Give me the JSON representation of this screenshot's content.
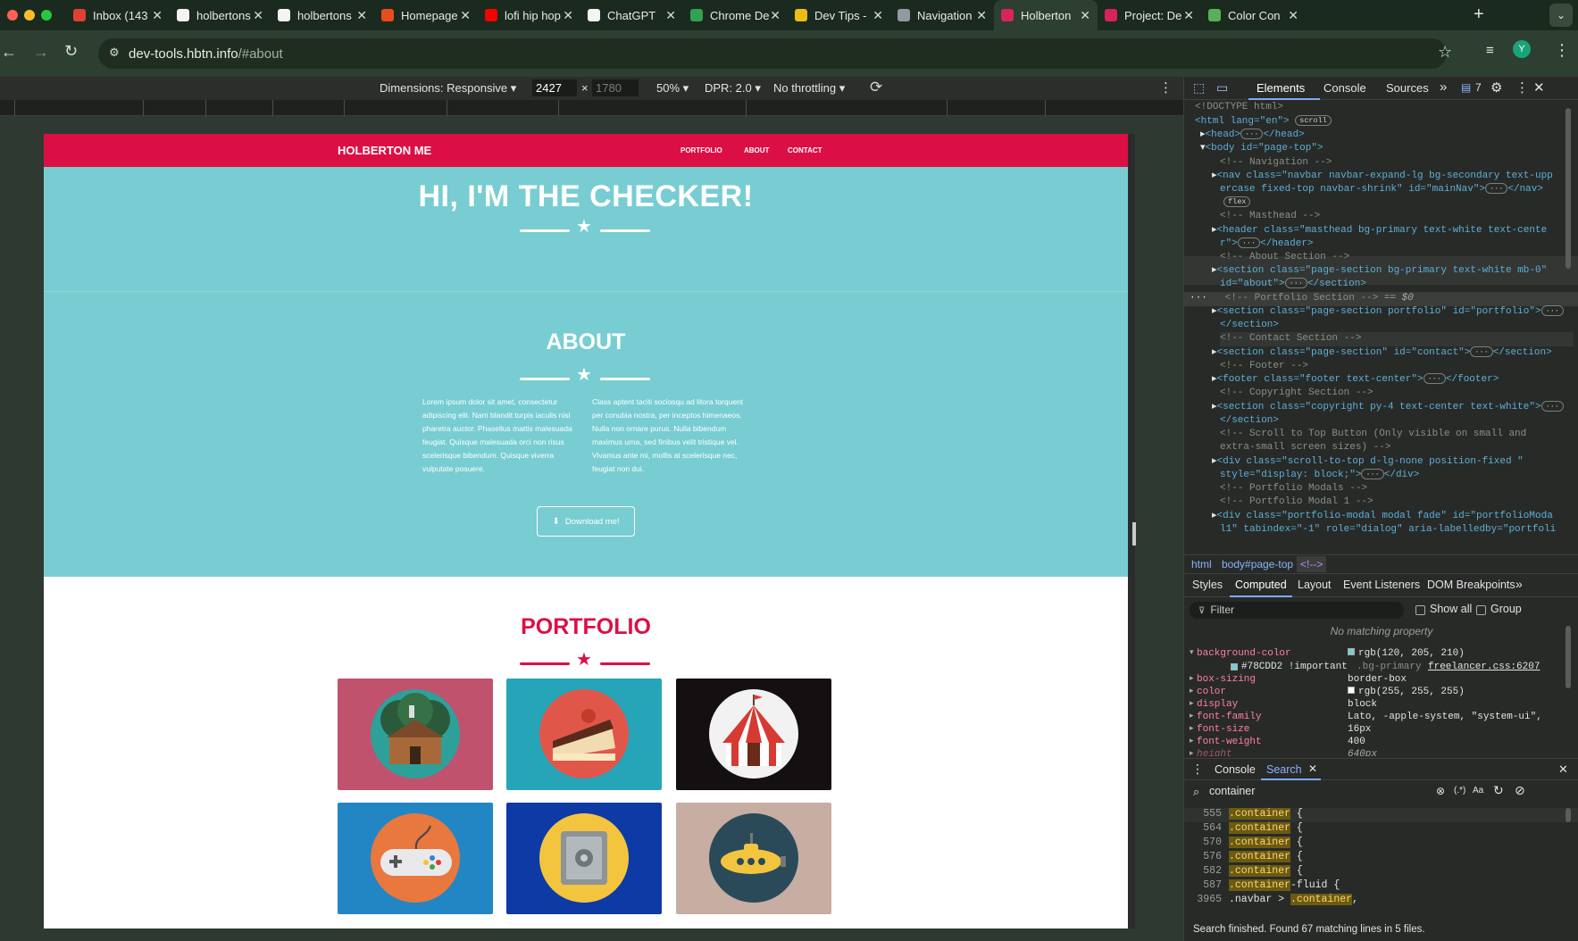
{
  "tabs": [
    {
      "label": "Inbox (143",
      "icon": "gmail-icon",
      "color": "#ea4335"
    },
    {
      "label": "holbertons",
      "icon": "github-icon",
      "color": "#ffffff"
    },
    {
      "label": "holbertons",
      "icon": "github-icon",
      "color": "#ffffff"
    },
    {
      "label": "Homepage",
      "icon": "figma-icon",
      "color": "#f24e1e"
    },
    {
      "label": "lofi hip hop",
      "icon": "youtube-icon",
      "color": "#ff0000"
    },
    {
      "label": "ChatGPT",
      "icon": "chatgpt-icon",
      "color": "#ffffff"
    },
    {
      "label": "Chrome De",
      "icon": "chrome-icon",
      "color": "#34a853"
    },
    {
      "label": "Dev Tips -",
      "icon": "devtips-icon",
      "color": "#f9c513"
    },
    {
      "label": "Navigation",
      "icon": "book-icon",
      "color": "#9aa0a6"
    },
    {
      "label": "Holberton",
      "icon": "holberton-icon",
      "color": "#e0245e"
    },
    {
      "label": "Project: De",
      "icon": "holberton-icon",
      "color": "#e0245e"
    },
    {
      "label": "Color Con",
      "icon": "webaim-icon",
      "color": "#5cb85c"
    }
  ],
  "browser": {
    "url_host": "dev-tools.hbtn.info",
    "url_path": "/#about",
    "profile_initial": "Y"
  },
  "device_bar": {
    "dimensions": "Dimensions: Responsive",
    "width": "2427",
    "height_placeholder": "1780",
    "times": "×",
    "zoom": "50%",
    "dpr": "DPR: 2.0",
    "throttling": "No throttling"
  },
  "site": {
    "brand": "HOLBERTON ME",
    "nav": [
      "PORTFOLIO",
      "ABOUT",
      "CONTACT"
    ],
    "hero_title": "HI, I'M THE CHECKER!",
    "about_title": "ABOUT",
    "about_left": "Lorem ipsum dolor sit amet, consectetur adipiscing elit. Nam blandit turpis iaculis nisl pharetra auctor. Phasellus mattis malesuada feugiat. Quisque malesuada orci non risus scelerisque bibendum. Quisque viverra vulputate posuere.",
    "about_right": "Class aptent taciti sociosqu ad litora torquent per conubia nostra, per inceptos himenaeos. Nulla non ornare purus. Nulla bibendum maximus urna, sed finibus velit tristique vel. Vivamus ante mi, mollis at scelerisque nec, feugiat non dui.",
    "download_label": "Download me!",
    "portfolio_title": "PORTFOLIO",
    "portfolio_items": [
      {
        "name": "cabin",
        "bg": "#c0526e"
      },
      {
        "name": "cake",
        "bg": "#26a5b8"
      },
      {
        "name": "circus",
        "bg": "#141011"
      },
      {
        "name": "game",
        "bg": "#2286c4"
      },
      {
        "name": "safe",
        "bg": "#0e3aa6"
      },
      {
        "name": "submarine",
        "bg": "#c8ada2"
      }
    ],
    "colors": {
      "primary": "#78CDD2",
      "secondary": "#DC0F45"
    }
  },
  "devtools": {
    "tabs": [
      "Elements",
      "Console",
      "Sources"
    ],
    "issues_count": "7",
    "crumbs": [
      "html",
      "body#page-top",
      "<!-->"
    ],
    "subtabs": [
      "Styles",
      "Computed",
      "Layout",
      "Event Listeners",
      "DOM Breakpoints"
    ],
    "filter_placeholder": "Filter",
    "show_all": "Show all",
    "group": "Group",
    "no_match": "No matching property",
    "computed": [
      {
        "prop": "background-color",
        "value": "rgb(120, 205, 210)"
      },
      {
        "prop": "box-sizing",
        "value": "border-box"
      },
      {
        "prop": "color",
        "value": "rgb(255, 255, 255)"
      },
      {
        "prop": "display",
        "value": "block"
      },
      {
        "prop": "font-family",
        "value": "Lato, -apple-system, \"system-ui\","
      },
      {
        "prop": "font-size",
        "value": "16px"
      },
      {
        "prop": "font-weight",
        "value": "400"
      },
      {
        "prop": "height",
        "value": "640px"
      }
    ],
    "bg_sub": {
      "value": "#78CDD2 !important",
      "selector": ".bg-primary",
      "source": "freelancer.css:6207"
    },
    "drawer_tabs": [
      "Console",
      "Search"
    ],
    "search_value": "container",
    "results": [
      {
        "line": "555",
        "pre": "",
        "match": ".container",
        "post": " {"
      },
      {
        "line": "564",
        "pre": "",
        "match": ".container",
        "post": " {"
      },
      {
        "line": "570",
        "pre": "",
        "match": ".container",
        "post": " {"
      },
      {
        "line": "576",
        "pre": "",
        "match": ".container",
        "post": " {"
      },
      {
        "line": "582",
        "pre": "",
        "match": ".container",
        "post": " {"
      },
      {
        "line": "587",
        "pre": "",
        "match": ".container",
        "post": "-fluid {"
      },
      {
        "line": "3965",
        "pre": ".navbar > ",
        "match": ".container",
        "post": ","
      }
    ],
    "search_status": "Search finished.  Found 67 matching lines in 5 files."
  },
  "dom": {
    "doctype": "<!DOCTYPE html>",
    "html_open": "<html lang=\"en\">",
    "html_badge": "scroll",
    "head": "<head>",
    "head_close": "</head>",
    "body": "<body id=\"page-top\">",
    "c_nav": "<!-- Navigation -->",
    "nav_a": "<nav class=\"navbar navbar-expand-lg bg-secondary text-upp",
    "nav_b": "ercase fixed-top navbar-shrink\" id=\"mainNav\">",
    "nav_end": "</nav>",
    "badge_flex": "flex",
    "c_masthead": "<!-- Masthead -->",
    "header_a": "<header class=\"masthead bg-primary text-white text-cente",
    "header_b": "r\">",
    "header_end": "</header>",
    "c_about": "<!-- About Section -->",
    "about_a": "<section class=\"page-section bg-primary text-white mb-0\"",
    "about_b": "id=\"about\">",
    "section_end": "</section>",
    "c_portfolio": "<!-- Portfolio Section -->",
    "sel_marker": "== $0",
    "port_a": "<section class=\"page-section portfolio\" id=\"portfolio\">",
    "c_contact": "<!-- Contact Section -->",
    "contact_a": "<section class=\"page-section\" id=\"contact\">",
    "c_footer": "<!-- Footer -->",
    "footer_a": "<footer class=\"footer text-center\">",
    "footer_end": "</footer>",
    "c_copyright": "<!-- Copyright Section -->",
    "copy_a": "<section class=\"copyright py-4 text-center text-white\">",
    "c_scroll_a": "<!-- Scroll to Top Button (Only visible on small and",
    "c_scroll_b": "extra-small screen sizes) -->",
    "div_a": "<div class=\"scroll-to-top d-lg-none position-fixed \"",
    "div_b": "style=\"display: block;\">",
    "div_end": "</div>",
    "c_modals": "<!-- Portfolio Modals -->",
    "c_modal1": "<!-- Portfolio Modal 1 -->",
    "modal_a": "<div class=\"portfolio-modal modal fade\" id=\"portfolioModa",
    "modal_b": "l1\" tabindex=\"-1\" role=\"dialog\" aria-labelledby=\"portfoli"
  }
}
